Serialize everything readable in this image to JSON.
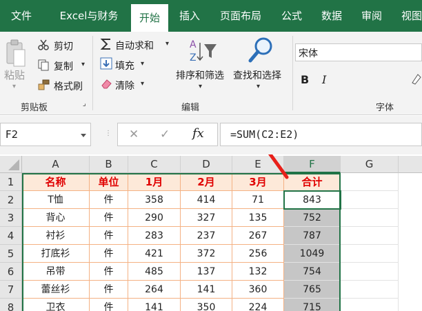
{
  "tabs": [
    {
      "label": "文件"
    },
    {
      "label": "Excel与财务"
    },
    {
      "label": "开始",
      "active": true
    },
    {
      "label": "插入"
    },
    {
      "label": "页面布局"
    },
    {
      "label": "公式"
    },
    {
      "label": "数据"
    },
    {
      "label": "审阅"
    },
    {
      "label": "视图"
    }
  ],
  "clipboard": {
    "paste": "粘贴",
    "cut": "剪切",
    "copy": "复制",
    "format_painter": "格式刷",
    "group_label": "剪贴板"
  },
  "editing": {
    "autosum": "自动求和",
    "fill": "填充",
    "clear": "清除",
    "sort_filter": "排序和筛选",
    "find_select": "查找和选择",
    "group_label": "编辑"
  },
  "font": {
    "name": "宋体",
    "bold": "B",
    "italic": "I",
    "group_label": "字体"
  },
  "formula_bar": {
    "name_box": "F2",
    "cancel": "✕",
    "enter": "✓",
    "fx": "fx",
    "formula": "=SUM(C2:E2)"
  },
  "columns": [
    "A",
    "B",
    "C",
    "D",
    "E",
    "F",
    "G"
  ],
  "rows": [
    {
      "num": "1",
      "cells": [
        "名称",
        "单位",
        "1月",
        "2月",
        "3月",
        "合计"
      ]
    },
    {
      "num": "2",
      "cells": [
        "T恤",
        "件",
        "358",
        "414",
        "71",
        "843"
      ]
    },
    {
      "num": "3",
      "cells": [
        "背心",
        "件",
        "290",
        "327",
        "135",
        "752"
      ]
    },
    {
      "num": "4",
      "cells": [
        "衬衫",
        "件",
        "283",
        "237",
        "267",
        "787"
      ]
    },
    {
      "num": "5",
      "cells": [
        "打底衫",
        "件",
        "421",
        "372",
        "256",
        "1049"
      ]
    },
    {
      "num": "6",
      "cells": [
        "吊带",
        "件",
        "485",
        "137",
        "132",
        "754"
      ]
    },
    {
      "num": "7",
      "cells": [
        "蕾丝衫",
        "件",
        "264",
        "141",
        "360",
        "765"
      ]
    },
    {
      "num": "8",
      "cells": [
        "卫衣",
        "件",
        "141",
        "350",
        "224",
        "715"
      ]
    }
  ],
  "colors": {
    "excel_green": "#217346",
    "header_fill": "#fde9d9",
    "header_text": "#e00000",
    "arrow": "#e8201a"
  }
}
